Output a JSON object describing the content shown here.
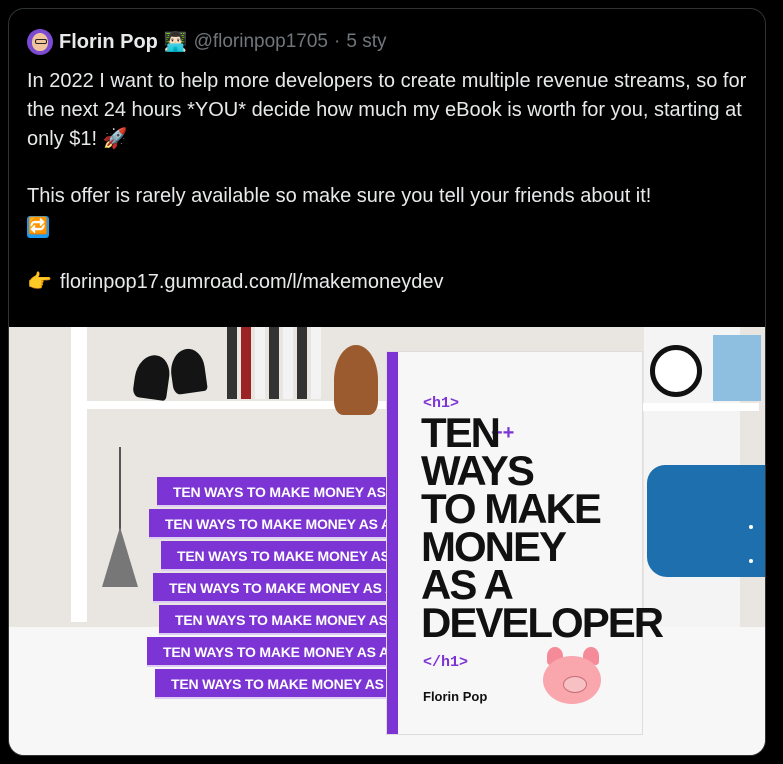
{
  "tweet": {
    "author": {
      "name": "Florin Pop",
      "emoji": "👨🏻‍💻",
      "handle": "@florinpop1705",
      "separator": "·",
      "time": "5 sty"
    },
    "text": {
      "p1": "In 2022 I want to help more developers to create multiple revenue streams, so for the next 24 hours *YOU* decide how much my eBook is worth for you, starting at only $1!",
      "rocket": "🚀",
      "p2": "This offer is rarely available so make sure you tell your friends about it!",
      "repeat_icon": "🔁",
      "pointer_icon": "👉",
      "link": "florinpop17.gumroad.com/l/makemoneydev"
    },
    "image": {
      "stack_labels": [
        "TEN WAYS TO MAKE MONEY AS A DEVEL",
        "TEN WAYS TO MAKE MONEY AS A DEVEI",
        "TEN WAYS TO MAKE MONEY AS A DEV",
        "TEN WAYS TO MAKE MONEY AS A DEVI",
        "TEN WAYS TO MAKE MONEY AS A DEV",
        "TEN WAYS TO MAKE MONEY AS A DEVELO",
        "TEN WAYS TO MAKE MONEY AS A DEVEI"
      ],
      "cover": {
        "open_tag": "<h1>",
        "plusplus": "++",
        "title_lines": [
          "TEN",
          "WAYS",
          "TO MAKE",
          "MONEY",
          "AS A",
          "DEVELOPER"
        ],
        "close_tag": "</h1>",
        "author": "Florin Pop"
      }
    }
  }
}
